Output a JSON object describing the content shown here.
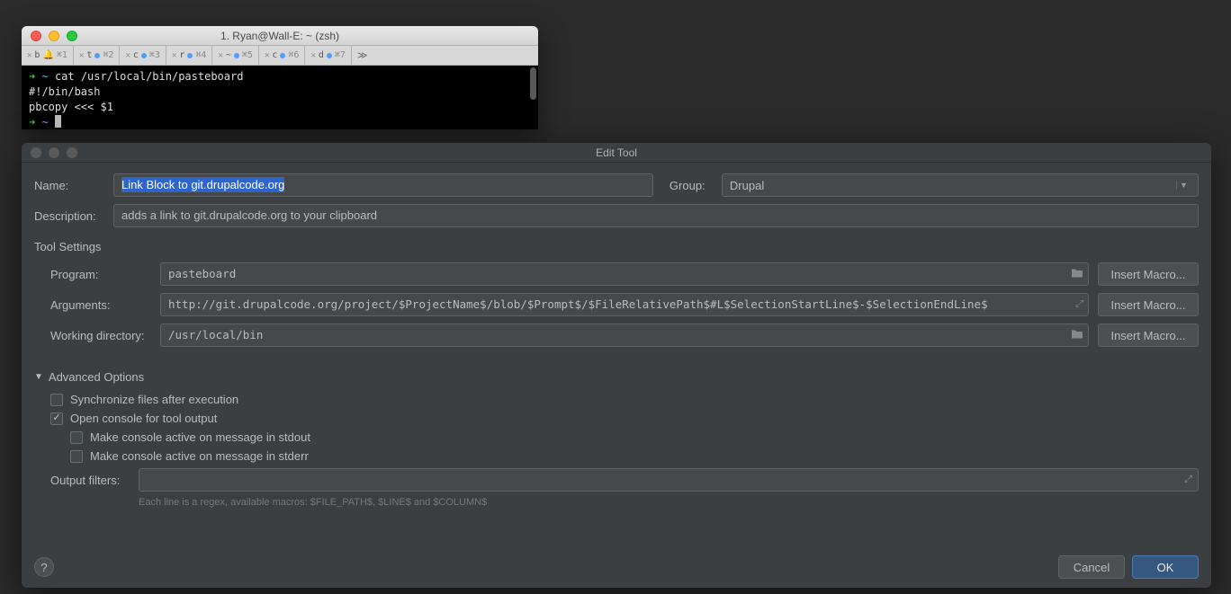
{
  "terminal": {
    "title": "1. Ryan@Wall-E: ~ (zsh)",
    "tabs": [
      {
        "letter": "b",
        "shortcut": "⌘1",
        "dotColor": "#8e8e8e"
      },
      {
        "letter": "t",
        "shortcut": "⌘2",
        "dotColor": "#4aa0ff"
      },
      {
        "letter": "c",
        "shortcut": "⌘3",
        "dotColor": "#4aa0ff"
      },
      {
        "letter": "r",
        "shortcut": "⌘4",
        "dotColor": "#4aa0ff"
      },
      {
        "letter": "~",
        "shortcut": "⌘5",
        "dotColor": "#4aa0ff"
      },
      {
        "letter": "c",
        "shortcut": "⌘6",
        "dotColor": "#4aa0ff"
      },
      {
        "letter": "d",
        "shortcut": "⌘7",
        "dotColor": "#4aa0ff"
      }
    ],
    "lines": {
      "cmd": "cat /usr/local/bin/pasteboard",
      "out1": "#!/bin/bash",
      "out2": "pbcopy <<< $1"
    }
  },
  "dialog": {
    "title": "Edit Tool",
    "labels": {
      "name": "Name:",
      "group": "Group:",
      "description": "Description:",
      "toolSettings": "Tool Settings",
      "program": "Program:",
      "arguments": "Arguments:",
      "workingDir": "Working directory:",
      "advanced": "Advanced Options",
      "outputFilters": "Output filters:",
      "insertMacro": "Insert Macro...",
      "cancel": "Cancel",
      "ok": "OK",
      "help": "?"
    },
    "values": {
      "name": "Link Block to git.drupalcode.org",
      "group": "Drupal",
      "description": "adds a link to git.drupalcode.org to your clipboard",
      "program": "pasteboard",
      "arguments": "http://git.drupalcode.org/project/$ProjectName$/blob/$Prompt$/$FileRelativePath$#L$SelectionStartLine$-$SelectionEndLine$",
      "workingDir": "/usr/local/bin",
      "outputFilters": ""
    },
    "checkboxes": {
      "sync": {
        "label": "Synchronize files after execution",
        "checked": false
      },
      "openConsole": {
        "label": "Open console for tool output",
        "checked": true
      },
      "stdoutActive": {
        "label": "Make console active on message in stdout",
        "checked": false
      },
      "stderrActive": {
        "label": "Make console active on message in stderr",
        "checked": false
      }
    },
    "hint": "Each line is a regex, available macros: $FILE_PATH$, $LINE$ and $COLUMN$"
  }
}
